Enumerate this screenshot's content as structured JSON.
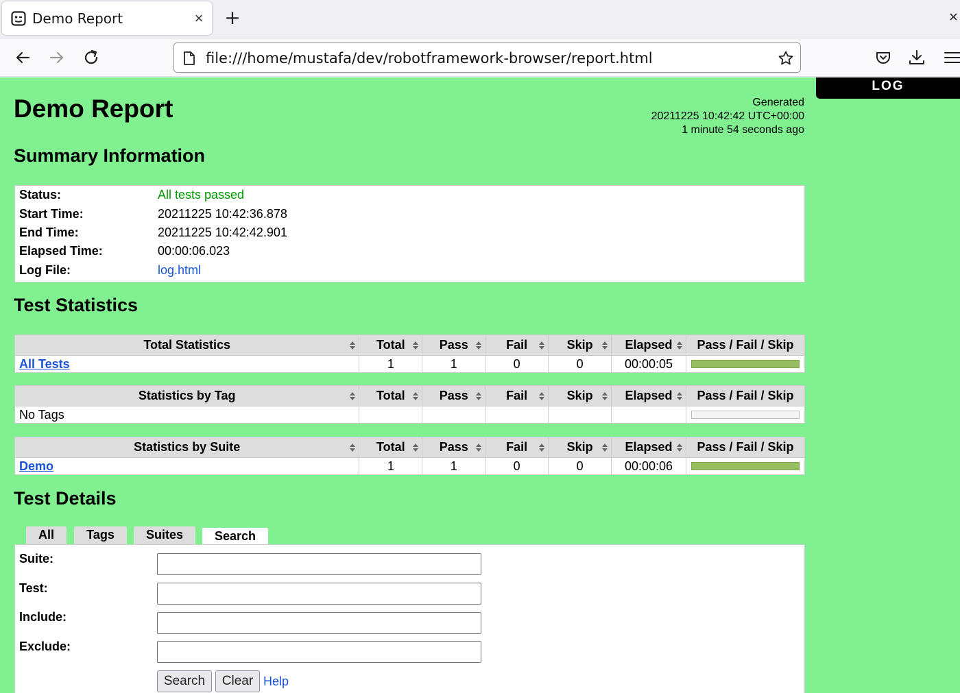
{
  "browser": {
    "tab_title": "Demo Report",
    "tab_close": "×",
    "new_tab": "+",
    "window_close": "×",
    "url": "file:///home/mustafa/dev/robotframework-browser/report.html"
  },
  "report": {
    "log_button": "LOG",
    "title": "Demo Report",
    "generated": {
      "label": "Generated",
      "timestamp": "20211225 10:42:42 UTC+00:00",
      "ago": "1 minute 54 seconds ago"
    },
    "summary_heading": "Summary Information",
    "summary": [
      {
        "label": "Status:",
        "value": "All tests passed"
      },
      {
        "label": "Start Time:",
        "value": "20211225 10:42:36.878"
      },
      {
        "label": "End Time:",
        "value": "20211225 10:42:42.901"
      },
      {
        "label": "Elapsed Time:",
        "value": "00:00:06.023"
      },
      {
        "label": "Log File:",
        "value": "log.html"
      }
    ],
    "statistics_heading": "Test Statistics",
    "columns": [
      "Total",
      "Pass",
      "Fail",
      "Skip",
      "Elapsed",
      "Pass / Fail / Skip"
    ],
    "tables": [
      {
        "title": "Total Statistics",
        "row": {
          "name": "All Tests",
          "total": "1",
          "pass": "1",
          "fail": "0",
          "skip": "0",
          "elapsed": "00:00:05",
          "pass_fraction": 1
        }
      },
      {
        "title": "Statistics by Tag",
        "row": {
          "name": "No Tags",
          "total": "",
          "pass": "",
          "fail": "",
          "skip": "",
          "elapsed": "",
          "pass_fraction": 0
        }
      },
      {
        "title": "Statistics by Suite",
        "row": {
          "name": "Demo",
          "total": "1",
          "pass": "1",
          "fail": "0",
          "skip": "0",
          "elapsed": "00:00:06",
          "pass_fraction": 1
        }
      }
    ],
    "details_heading": "Test Details",
    "detail_tabs": [
      "All",
      "Tags",
      "Suites",
      "Search"
    ],
    "active_tab": "Search",
    "search": {
      "fields": [
        {
          "label": "Suite:",
          "value": ""
        },
        {
          "label": "Test:",
          "value": ""
        },
        {
          "label": "Include:",
          "value": ""
        },
        {
          "label": "Exclude:",
          "value": ""
        }
      ],
      "search_button": "Search",
      "clear_button": "Clear",
      "help_link": "Help"
    }
  },
  "colors": {
    "page_background": "#80f090",
    "pass_bar": "#97bd61",
    "link": "#1a55d6",
    "status_passed": "#009900"
  }
}
